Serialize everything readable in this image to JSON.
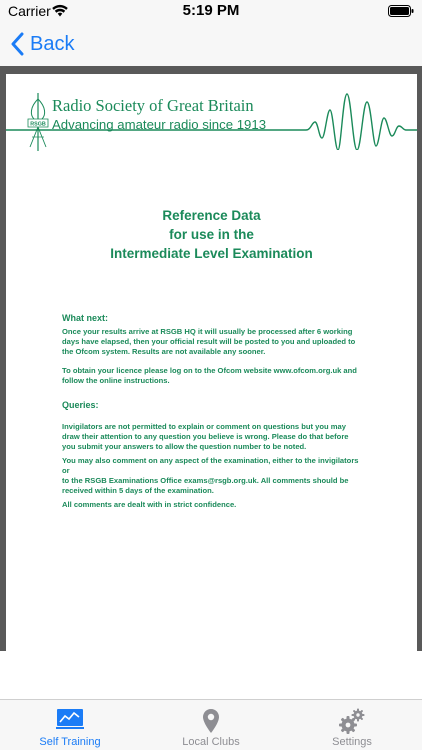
{
  "status_bar": {
    "carrier": "Carrier",
    "time": "5:19 PM",
    "icons": [
      "wifi-icon",
      "battery-icon"
    ]
  },
  "nav": {
    "back_label": "Back",
    "back_icon": "chevron-left-icon"
  },
  "document": {
    "org_name": "Radio Society of Great Britain",
    "org_tagline": "Advancing amateur radio since 1913",
    "logo_text": "RSGB",
    "title_lines": [
      "Reference Data",
      "for use in the",
      "Intermediate Level Examination"
    ],
    "what_next_heading": "What next:",
    "what_next_lines": [
      "Once your results arrive at RSGB HQ it will usually be processed after 6 working",
      "days have elapsed, then your official result will be posted to you and uploaded to",
      "the Ofcom system.   Results are not available any sooner."
    ],
    "licence_lines": [
      "To obtain your licence please log on to the Ofcom website www.ofcom.org.uk and",
      "follow the online instructions."
    ],
    "queries_heading": "Queries:",
    "queries_lines": [
      "Invigilators are not permitted to explain or comment on questions but you may",
      "draw their attention to any question you believe is wrong. Please do  that before",
      "you submit your answers to allow the question number to be noted."
    ],
    "comment_lines": [
      "You may also comment on any aspect of the examination, either to the invigilators",
      "or",
      "to the RSGB Examinations Office exams@rsgb.org.uk.  All comments should be",
      "received within 5 days of the examination."
    ],
    "confidence_line": "All comments are dealt with in strict confidence.",
    "accent_color": "#1b8a5a"
  },
  "tabs": [
    {
      "label": "Self Training",
      "icon": "chart-icon",
      "active": true
    },
    {
      "label": "Local Clubs",
      "icon": "location-pin-icon",
      "active": false
    },
    {
      "label": "Settings",
      "icon": "gears-icon",
      "active": false
    }
  ],
  "colors": {
    "tint": "#1b7cf6",
    "inactive": "#8e8e93",
    "bar_background": "#f7f7f7",
    "frame_background": "#595959"
  }
}
